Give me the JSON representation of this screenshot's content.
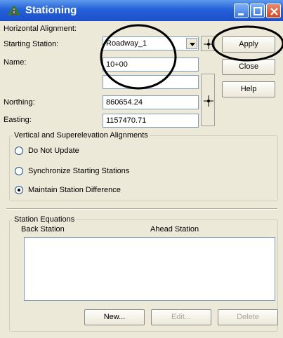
{
  "window": {
    "title": "Stationing",
    "title_icon": "road-icon"
  },
  "title_buttons": {
    "minimize": "minimize-icon",
    "maximize": "maximize-icon",
    "close": "close-icon"
  },
  "form": {
    "horizontal_alignment_label": "Horizontal Alignment:",
    "horizontal_alignment_value": "Roadway_1",
    "starting_station_label": "Starting Station:",
    "starting_station_value": "10+00",
    "name_label": "Name:",
    "name_value": "",
    "northing_label": "Northing:",
    "northing_value": "860654.24",
    "easting_label": "Easting:",
    "easting_value": "1157470.71"
  },
  "buttons": {
    "apply": "Apply",
    "close": "Close",
    "help": "Help"
  },
  "vertical_group": {
    "title": "Vertical and Superelevation Alignments",
    "options": [
      {
        "label": "Do Not Update",
        "checked": false
      },
      {
        "label": "Synchronize Starting Stations",
        "checked": false
      },
      {
        "label": "Maintain Station Difference",
        "checked": true
      }
    ]
  },
  "equations_group": {
    "title": "Station Equations",
    "col_back": "Back Station",
    "col_ahead": "Ahead Station",
    "rows": [],
    "new_button": "New...",
    "edit_button": "Edit...",
    "delete_button": "Delete"
  },
  "annotations": {
    "circle_color": "#000000"
  }
}
